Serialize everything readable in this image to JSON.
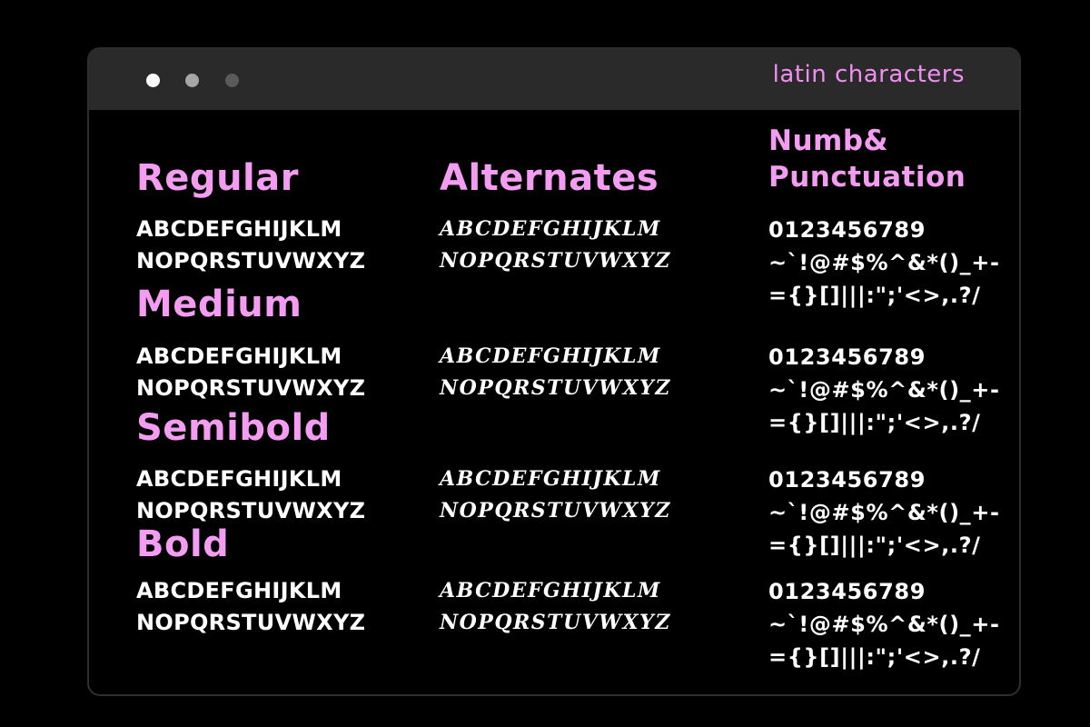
{
  "window": {
    "title": "latin characters"
  },
  "headings": {
    "regular": "Regular",
    "medium": "Medium",
    "semibold": "Semibold",
    "bold": "Bold",
    "alternates": "Alternates",
    "numb_line1": "Numb&",
    "numb_line2": "Punctuation"
  },
  "weights": [
    {
      "latin": [
        "ABCDEFGHIJKLM",
        "NOPQRSTUVWXYZ"
      ],
      "alternates": [
        "ABCDEFGHIJKLM",
        "NOPQRSTUVWXYZ"
      ],
      "numbers": [
        "0123456789",
        "~`!@#$%^&*()_+-",
        "={}[]|||:\";'<>,.?/"
      ]
    },
    {
      "latin": [
        "ABCDEFGHIJKLM",
        "NOPQRSTUVWXYZ"
      ],
      "alternates": [
        "ABCDEFGHIJKLM",
        "NOPQRSTUVWXYZ"
      ],
      "numbers": [
        "0123456789",
        "~`!@#$%^&*()_+-",
        "={}[]|||:\";'<>,.?/"
      ]
    },
    {
      "latin": [
        "ABCDEFGHIJKLM",
        "NOPQRSTUVWXYZ"
      ],
      "alternates": [
        "ABCDEFGHIJKLM",
        "NOPQRSTUVWXYZ"
      ],
      "numbers": [
        "0123456789",
        "~`!@#$%^&*()_+-",
        "={}[]|||:\";'<>,.?/"
      ]
    },
    {
      "latin": [
        "ABCDEFGHIJKLM",
        "NOPQRSTUVWXYZ"
      ],
      "alternates": [
        "ABCDEFGHIJKLM",
        "NOPQRSTUVWXYZ"
      ],
      "numbers": [
        "0123456789",
        "~`!@#$%^&*()_+-",
        "={}[]|||:\";'<>,.?/"
      ]
    }
  ],
  "colors": {
    "background": "#000000",
    "titlebar": "#2a2a2a",
    "accent_pink": "#f39cf2",
    "text": "#ffffff"
  }
}
